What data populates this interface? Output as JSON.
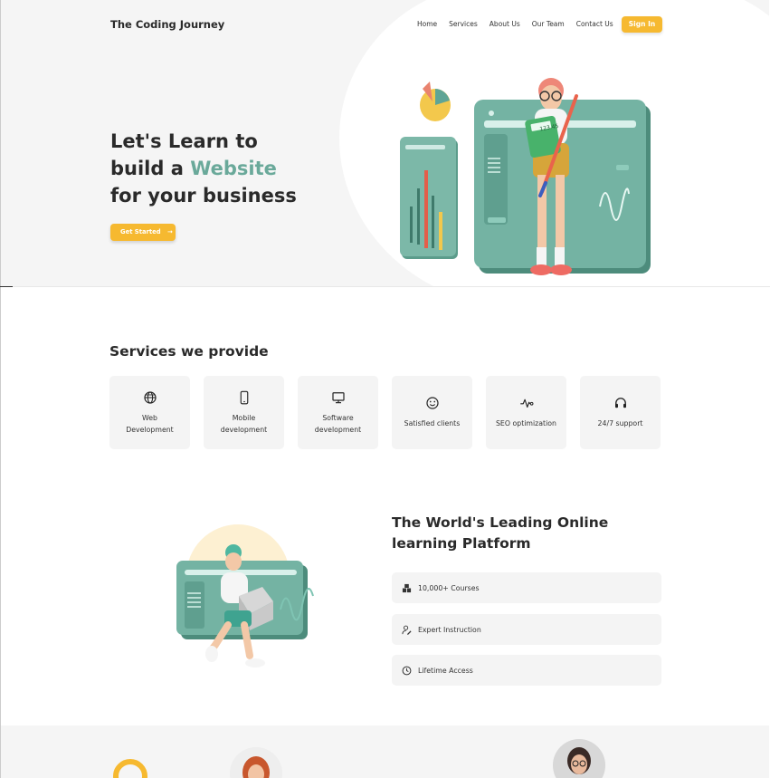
{
  "header": {
    "brand": "The Coding Journey",
    "nav": [
      "Home",
      "Services",
      "About Us",
      "Our Team",
      "Contact Us"
    ],
    "signin": "Sign In"
  },
  "hero": {
    "line1": "Let's Learn to",
    "line2_prefix": "build a ",
    "line2_highlight": "Website",
    "line3": "for your business",
    "cta": "Get Started",
    "cta_arrow": "→",
    "calc_text": "123.45"
  },
  "services": {
    "title": "Services we provide",
    "items": [
      {
        "label": "Web Development",
        "icon": "globe-icon"
      },
      {
        "label": "Mobile development",
        "icon": "mobile-icon"
      },
      {
        "label": "Software development",
        "icon": "monitor-icon"
      },
      {
        "label": "Satisfied clients",
        "icon": "smile-icon"
      },
      {
        "label": "SEO optimization",
        "icon": "pulse-icon"
      },
      {
        "label": "24/7 support",
        "icon": "headset-icon"
      }
    ]
  },
  "platform": {
    "title": "The World's Leading Online learning Platform",
    "features": [
      {
        "label": "10,000+ Courses",
        "icon": "boxes-icon"
      },
      {
        "label": "Expert Instruction",
        "icon": "user-edit-icon"
      },
      {
        "label": "Lifetime Access",
        "icon": "clock-icon"
      }
    ]
  },
  "colors": {
    "accent": "#f6b930",
    "brand_green": "#6aa99a",
    "text": "#2a2a2a",
    "card_bg": "#f4f4f4"
  }
}
